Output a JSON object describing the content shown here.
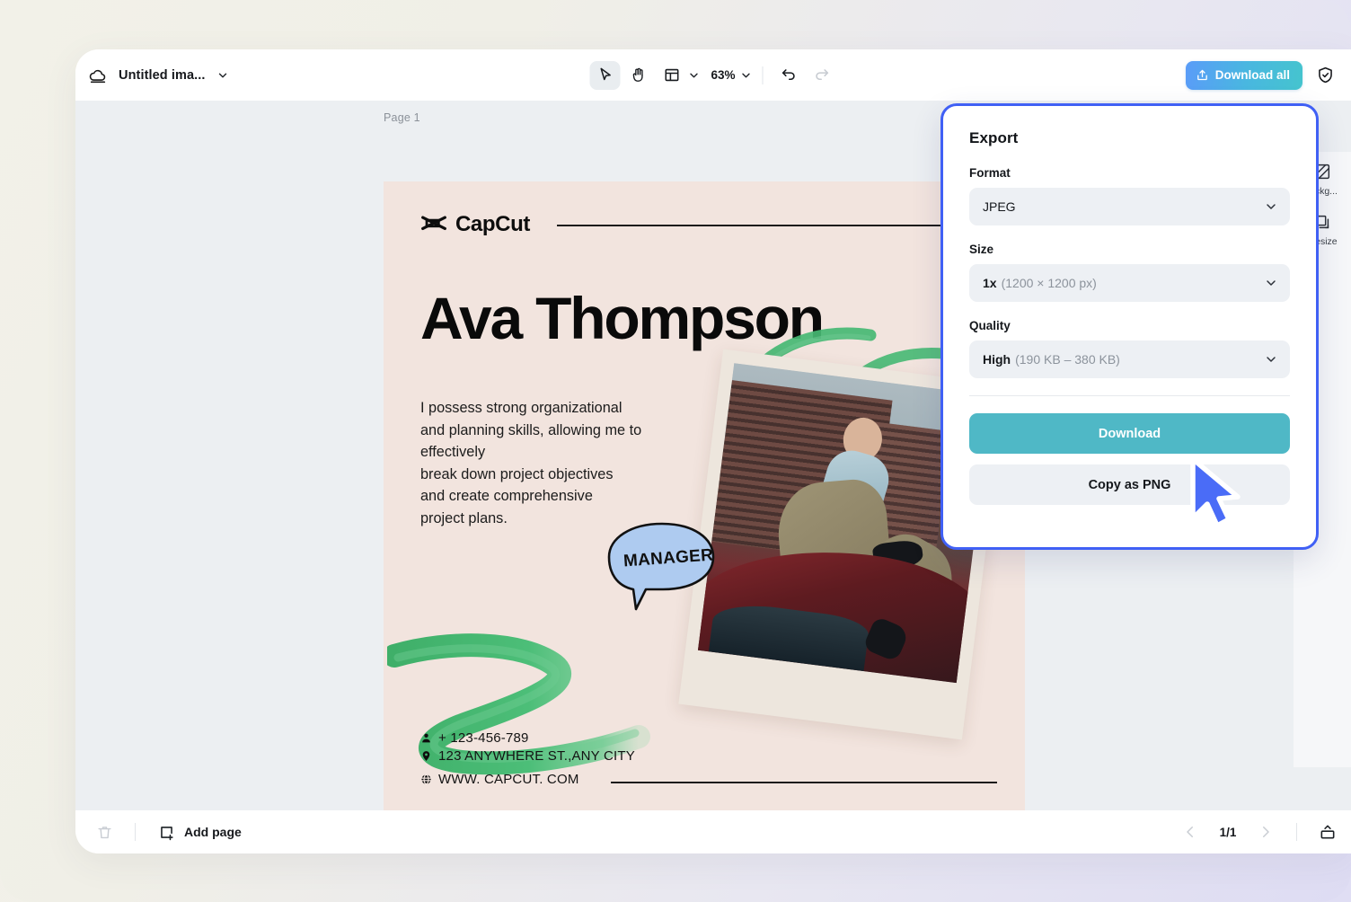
{
  "app": {
    "document_title": "Untitled ima...",
    "cloud_icon": "cloud-sync-icon",
    "title_chevron_icon": "chevron-down-icon"
  },
  "toolbar": {
    "select_tool": "cursor-select-tool",
    "hand_tool": "hand-pan-tool",
    "layout_tool": "layout-grid-tool",
    "layout_chevron": "chevron-down-icon",
    "zoom_level": "63%",
    "zoom_chevron": "chevron-down-icon",
    "undo": "undo-icon",
    "redo": "redo-icon",
    "download_all_label": "Download all",
    "download_all_icon": "upload-share-icon",
    "shield_icon": "shield-check-icon"
  },
  "canvas": {
    "page_label": "Page 1",
    "artboard_bg": "#F2E4DE"
  },
  "poster": {
    "brand": "CapCut",
    "name": "Ava Thompson",
    "body": "I possess strong organizational and planning skills, allowing me to effectively\nbreak down project objectives and create comprehensive project plans.",
    "body_lines": [
      "I possess strong organizational",
      "and planning skills, allowing me to",
      "effectively",
      "break down project objectives",
      "and create comprehensive",
      "project plans."
    ],
    "badge_text": "MANAGER",
    "badge_color": "#AECBF0",
    "brush_color": "#44B56F",
    "contacts": [
      {
        "icon": "person-icon",
        "text": "+ 123-456-789"
      },
      {
        "icon": "location-pin-icon",
        "text": "123 ANYWHERE ST.,ANY CITY"
      },
      {
        "icon": "globe-icon",
        "text": "WWW. CAPCUT. COM"
      }
    ]
  },
  "right_rail": {
    "items": [
      {
        "icon": "remove-background-icon",
        "label": "...ckg..."
      },
      {
        "icon": "resize-icon",
        "label": "...esize"
      }
    ]
  },
  "export_panel": {
    "title": "Export",
    "accent_border": "#4060F5",
    "fields": [
      {
        "label": "Format",
        "value": "JPEG",
        "detail": "",
        "chevron": "chevron-down-icon"
      },
      {
        "label": "Size",
        "value": "1x",
        "detail": "(1200 × 1200 px)",
        "chevron": "chevron-down-icon"
      },
      {
        "label": "Quality",
        "value": "High",
        "detail": "(190 KB – 380 KB)",
        "chevron": "chevron-down-icon"
      }
    ],
    "primary_button": "Download",
    "primary_color": "#4FB8C6",
    "secondary_button": "Copy as PNG"
  },
  "bottombar": {
    "delete_icon": "trash-icon",
    "add_page_label": "Add page",
    "add_page_icon": "add-page-icon",
    "prev_icon": "chevron-left-icon",
    "next_icon": "chevron-right-icon",
    "page_indicator": "1/1",
    "present_icon": "present-export-icon"
  },
  "cursor": {
    "name": "mouse-pointer",
    "color": "#4A6CF7"
  }
}
